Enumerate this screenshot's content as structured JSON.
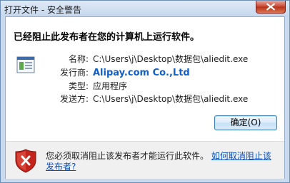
{
  "window": {
    "title": "打开文件 - 安全警告"
  },
  "dialog": {
    "headline": "已经阻止此发布者在您的计算机上运行软件。",
    "file_icon": "application-file-icon",
    "fields": {
      "name_label": "名称:",
      "name_value": "C:\\Users\\j\\Desktop\\数据包\\aliedit.exe",
      "publisher_label": "发行商:",
      "publisher_value": "Alipay.com Co.,Ltd",
      "type_label": "类型:",
      "type_value": "应用程序",
      "from_label": "发送方:",
      "from_value": "C:\\Users\\j\\Desktop\\数据包\\aliedit.exe"
    },
    "ok_label": "确定(O)"
  },
  "footer": {
    "shield_icon": "security-shield-icon",
    "warning_text": "您必须取消阻止该发布者才能运行此软件。",
    "help_link": "如何取消阻止该发布者?"
  },
  "colors": {
    "link": "#1060c8",
    "close_button": "#c8452f"
  }
}
